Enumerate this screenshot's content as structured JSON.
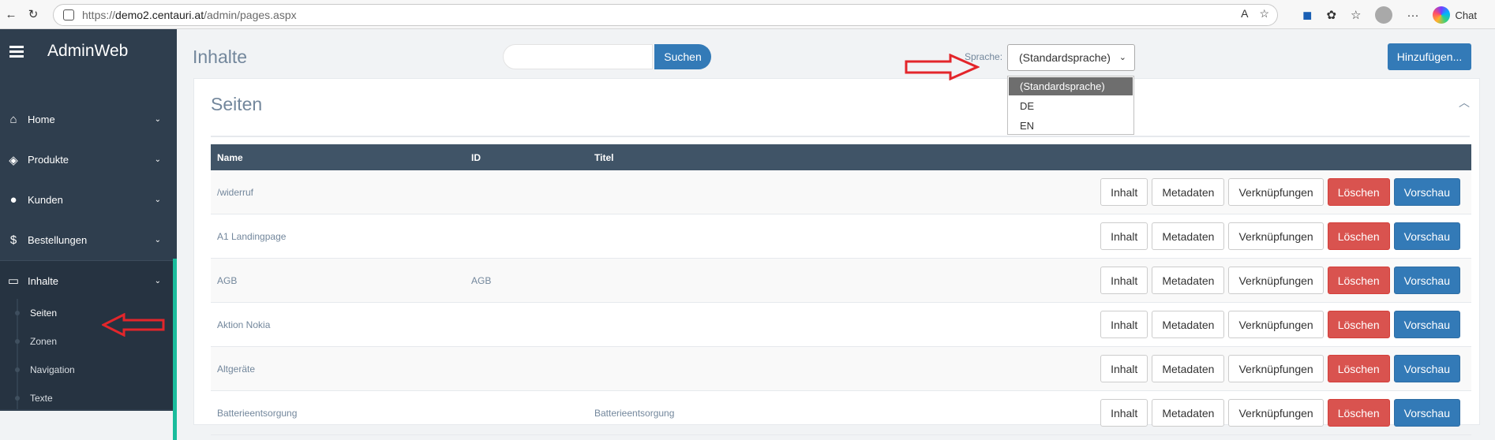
{
  "browser": {
    "url_prefix": "https://",
    "url_host": "demo2.centauri.at",
    "url_path": "/admin/pages.aspx",
    "chat_label": "Chat"
  },
  "sidebar": {
    "brand": "AdminWeb",
    "items": [
      {
        "label": "Home",
        "icon": "home-icon",
        "glyph": "⌂"
      },
      {
        "label": "Produkte",
        "icon": "cube-icon",
        "glyph": "◈"
      },
      {
        "label": "Kunden",
        "icon": "user-icon",
        "glyph": "●"
      },
      {
        "label": "Bestellungen",
        "icon": "dollar-icon",
        "glyph": "$"
      },
      {
        "label": "Inhalte",
        "icon": "monitor-icon",
        "glyph": "▭"
      }
    ],
    "subitems": [
      "Seiten",
      "Zonen",
      "Navigation",
      "Texte"
    ]
  },
  "header": {
    "title": "Inhalte",
    "search_button": "Suchen",
    "search_value": "",
    "language_label": "Sprache:",
    "language_selected": "(Standardsprache)",
    "language_options": [
      "(Standardsprache)",
      "DE",
      "EN"
    ],
    "add_button": "Hinzufügen..."
  },
  "panel": {
    "title": "Seiten",
    "columns": [
      "Name",
      "ID",
      "Titel"
    ],
    "actions": [
      "Inhalt",
      "Metadaten",
      "Verknüpfungen",
      "Löschen",
      "Vorschau"
    ],
    "rows": [
      {
        "name": "/widerruf",
        "id": "",
        "titel": ""
      },
      {
        "name": "A1 Landingpage",
        "id": "",
        "titel": ""
      },
      {
        "name": "AGB",
        "id": "AGB",
        "titel": ""
      },
      {
        "name": "Aktion Nokia",
        "id": "",
        "titel": ""
      },
      {
        "name": "Altgeräte",
        "id": "",
        "titel": ""
      },
      {
        "name": "Batterieentsorgung",
        "id": "",
        "titel": "Batterieentsorgung"
      }
    ]
  },
  "colors": {
    "sidebar": "#2f3e4e",
    "accent": "#1abc9c",
    "primary": "#337ab7",
    "danger": "#d9534f",
    "table_header": "#405467",
    "annotation": "#e3262b"
  }
}
